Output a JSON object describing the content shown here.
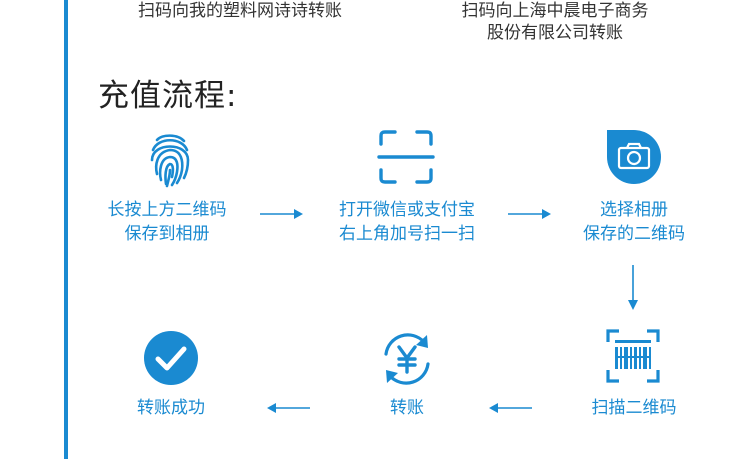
{
  "captions": {
    "left": {
      "line1": "扫码向我的塑料网诗诗转账"
    },
    "right": {
      "line1": "扫码向上海中晨电子商务",
      "line2": "股份有限公司转账"
    }
  },
  "heading": "充值流程:",
  "steps": [
    {
      "line1": "长按上方二维码",
      "line2": "保存到相册",
      "icon": "fingerprint-icon"
    },
    {
      "line1": "打开微信或支付宝",
      "line2": "右上角加号扫一扫",
      "icon": "scan-frame-icon"
    },
    {
      "line1": "选择相册",
      "line2": "保存的二维码",
      "icon": "camera-icon"
    },
    {
      "line1": "扫描二维码",
      "icon": "barcode-scan-icon"
    },
    {
      "line1": "转账",
      "icon": "yuan-transfer-icon"
    },
    {
      "line1": "转账成功",
      "icon": "checkmark-icon"
    }
  ],
  "colors": {
    "accent": "#1a8ad1",
    "text": "#333333",
    "arrow": "#1a8ad1"
  }
}
